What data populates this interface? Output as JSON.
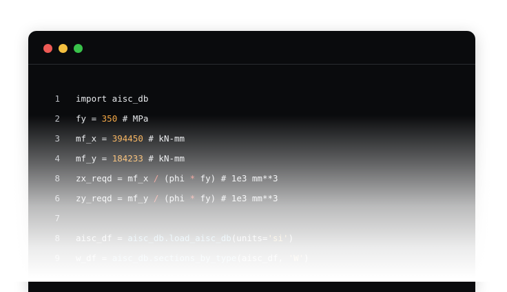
{
  "window": {
    "controls": {
      "close_color": "#ee5a55",
      "minimize_color": "#f4bf3f",
      "maximize_color": "#39c24a"
    }
  },
  "code": {
    "lines": [
      {
        "num": "1",
        "parts": [
          {
            "t": "import aisc_db",
            "c": ""
          }
        ]
      },
      {
        "num": "2",
        "parts": [
          {
            "t": "fy = ",
            "c": ""
          },
          {
            "t": "350",
            "c": "num"
          },
          {
            "t": " # MPa",
            "c": ""
          }
        ]
      },
      {
        "num": "3",
        "parts": [
          {
            "t": "mf_x = ",
            "c": ""
          },
          {
            "t": "394450",
            "c": "num"
          },
          {
            "t": " # kN-mm",
            "c": ""
          }
        ]
      },
      {
        "num": "4",
        "parts": [
          {
            "t": "mf_y = ",
            "c": ""
          },
          {
            "t": "184233",
            "c": "num"
          },
          {
            "t": " # kN-mm",
            "c": ""
          }
        ]
      },
      {
        "num": "8",
        "parts": [
          {
            "t": "zx_reqd = mf_x ",
            "c": ""
          },
          {
            "t": "/",
            "c": "op"
          },
          {
            "t": " (phi ",
            "c": ""
          },
          {
            "t": "*",
            "c": "op"
          },
          {
            "t": " fy) # 1e3 mm**3",
            "c": ""
          }
        ]
      },
      {
        "num": "6",
        "parts": [
          {
            "t": "zy_reqd = mf_y ",
            "c": ""
          },
          {
            "t": "/",
            "c": "op"
          },
          {
            "t": " (phi ",
            "c": ""
          },
          {
            "t": "*",
            "c": "op"
          },
          {
            "t": " fy) # 1e3 mm**3",
            "c": ""
          }
        ]
      },
      {
        "num": "7",
        "parts": []
      },
      {
        "num": "8",
        "parts": [
          {
            "t": "aisc_df = ",
            "c": ""
          },
          {
            "t": "aisc_db.load_aisc_db",
            "c": "fn"
          },
          {
            "t": "(units=",
            "c": ""
          },
          {
            "t": "'si'",
            "c": "str"
          },
          {
            "t": ")",
            "c": ""
          }
        ]
      },
      {
        "num": "9",
        "parts": [
          {
            "t": "w_df = ",
            "c": ""
          },
          {
            "t": "aisc_db.sections_by_type",
            "c": "fn"
          },
          {
            "t": "(aisc_df, ",
            "c": ""
          },
          {
            "t": "'W'",
            "c": "str"
          },
          {
            "t": ")",
            "c": ""
          }
        ]
      }
    ]
  }
}
